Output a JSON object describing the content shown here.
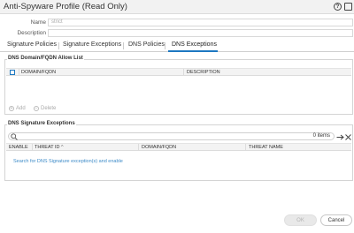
{
  "dialog": {
    "title": "Anti-Spyware Profile (Read Only)",
    "help_icon": "?",
    "maximize_icon": "▢"
  },
  "form": {
    "name_label": "Name",
    "name_value": "strict",
    "description_label": "Description",
    "description_value": ""
  },
  "tabs": [
    {
      "label": "Signature Policies"
    },
    {
      "label": "Signature Exceptions"
    },
    {
      "label": "DNS Policies"
    },
    {
      "label": "DNS Exceptions",
      "active": true
    }
  ],
  "allow_list": {
    "title": "DNS Domain/FQDN Allow List",
    "columns": [
      "DOMAIN/FQDN",
      "DESCRIPTION"
    ],
    "add_label": "Add",
    "delete_label": "Delete"
  },
  "exceptions": {
    "title": "DNS Signature Exceptions",
    "item_count": "0 items",
    "columns": [
      "ENABLE",
      "THREAT ID",
      "DOMAIN/FQDN",
      "THREAT NAME"
    ],
    "sort_indicator": "^",
    "empty_message": "Search for DNS Signature exception(s) and enable"
  },
  "footer": {
    "ok_label": "OK",
    "cancel_label": "Cancel"
  },
  "colors": {
    "accent": "#1d78c1",
    "link": "#3d8bc8"
  }
}
